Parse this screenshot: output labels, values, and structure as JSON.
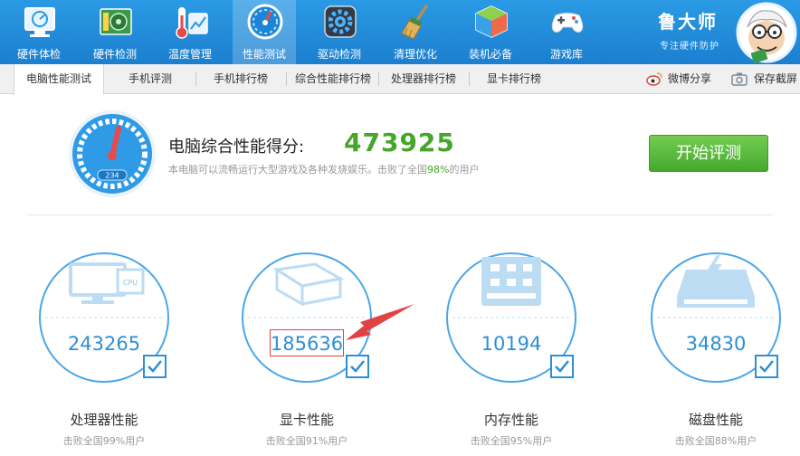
{
  "nav": {
    "items": [
      {
        "label": "硬件体检",
        "icon": "hardware-checkup-icon"
      },
      {
        "label": "硬件检测",
        "icon": "hardware-detect-icon"
      },
      {
        "label": "温度管理",
        "icon": "temperature-icon"
      },
      {
        "label": "性能测试",
        "icon": "performance-gauge-icon",
        "active": true
      },
      {
        "label": "驱动检测",
        "icon": "driver-gear-icon"
      },
      {
        "label": "清理优化",
        "icon": "broom-icon"
      },
      {
        "label": "装机必备",
        "icon": "software-box-icon"
      },
      {
        "label": "游戏库",
        "icon": "gamepad-icon"
      }
    ]
  },
  "brand": {
    "name": "鲁大师",
    "slogan": "专注硬件防护"
  },
  "tabs": [
    {
      "label": "电脑性能测试",
      "active": true
    },
    {
      "label": "手机评测"
    },
    {
      "label": "手机排行榜"
    },
    {
      "label": "综合性能排行榜"
    },
    {
      "label": "处理器排行榜"
    },
    {
      "label": "显卡排行榜"
    }
  ],
  "tools": {
    "weibo_share": "微博分享",
    "save_screenshot": "保存截屏"
  },
  "summary": {
    "title": "电脑综合性能得分:",
    "score": "473925",
    "desc_prefix": "本电脑可以流畅运行大型游戏及各种发烧娱乐。击败了全国",
    "desc_percent": "98%",
    "desc_suffix": "的用户",
    "gauge_readout": "234",
    "start_button": "开始评测"
  },
  "cards": [
    {
      "title": "处理器性能",
      "score": "243265",
      "sub": "击败全国99%用户",
      "icon": "cpu-monitor-icon",
      "icon_label": "CPU"
    },
    {
      "title": "显卡性能",
      "score": "185636",
      "sub": "击败全国91%用户",
      "icon": "gpu-cube-icon",
      "highlighted": true
    },
    {
      "title": "内存性能",
      "score": "10194",
      "sub": "击败全国95%用户",
      "icon": "memory-chip-icon"
    },
    {
      "title": "磁盘性能",
      "score": "34830",
      "sub": "击败全国88%用户",
      "icon": "disk-drive-icon"
    }
  ],
  "colors": {
    "accent_blue": "#2d8fd6",
    "score_green": "#44a62a",
    "topbar": "#1f8ad8",
    "highlight_red": "#e34242"
  }
}
